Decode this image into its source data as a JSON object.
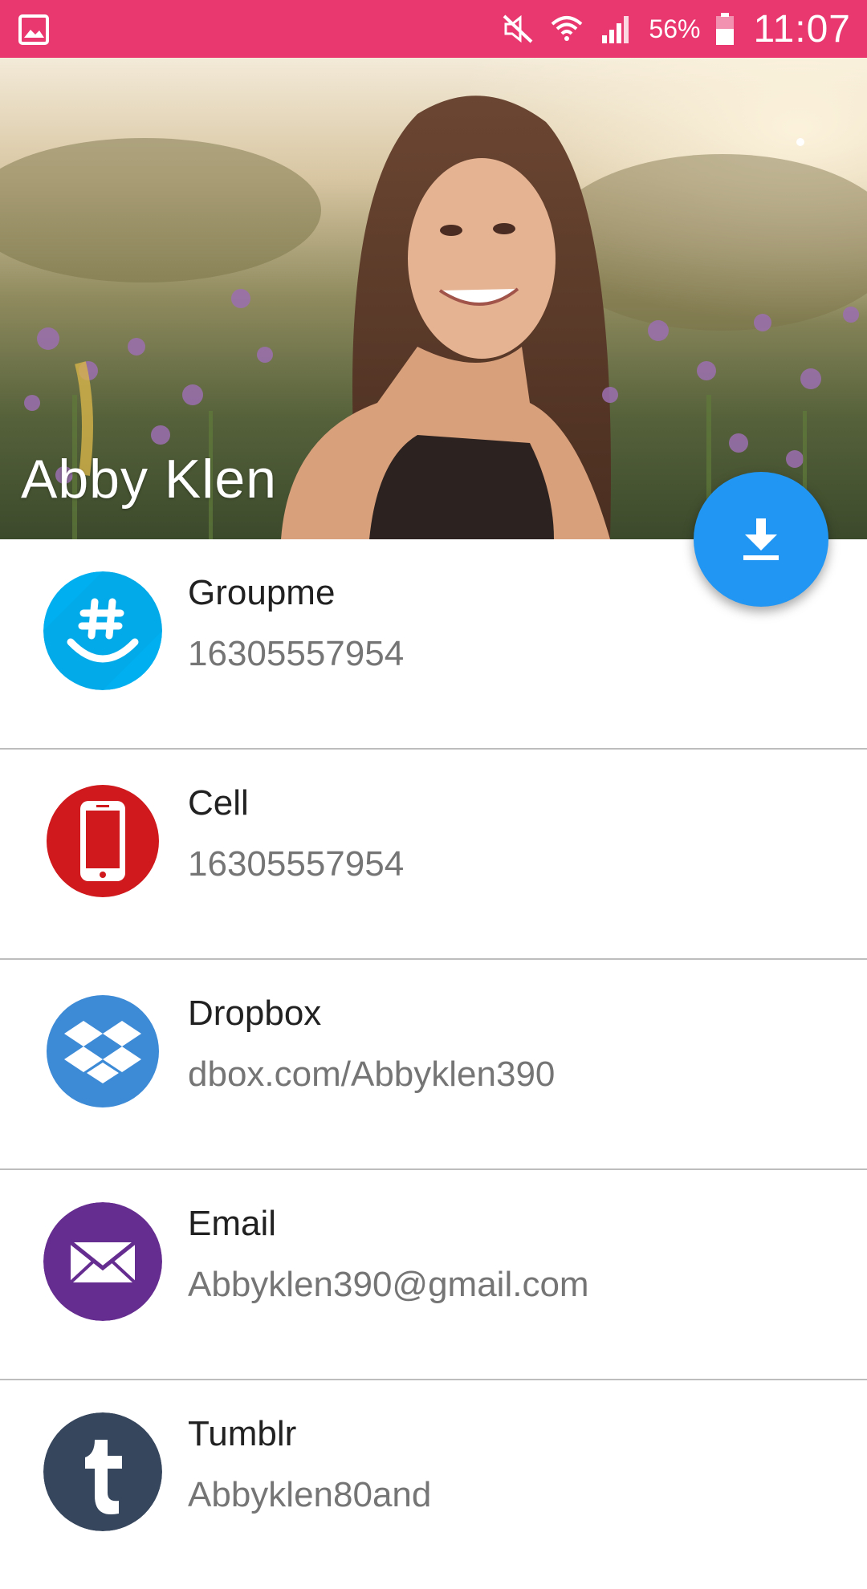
{
  "status_bar": {
    "battery": "56%",
    "time": "11:07",
    "background_color": "#e8386f",
    "icons": [
      "image-icon",
      "mute-icon",
      "wifi-icon",
      "signal-icon",
      "battery-icon"
    ]
  },
  "contact": {
    "name": "Abby  Klen"
  },
  "fab": {
    "icon": "download-icon",
    "color": "#2196f3"
  },
  "entries": [
    {
      "service": "Groupme",
      "value": "16305557954",
      "icon": "groupme-icon",
      "color": "#00aff0"
    },
    {
      "service": "Cell",
      "value": "16305557954",
      "icon": "phone-icon",
      "color": "#d0191c"
    },
    {
      "service": "Dropbox",
      "value": "dbox.com/Abbyklen390",
      "icon": "dropbox-icon",
      "color": "#3d8ad6"
    },
    {
      "service": "Email",
      "value": "Abbyklen390@gmail.com",
      "icon": "mail-icon",
      "color": "#662d91"
    },
    {
      "service": "Tumblr",
      "value": "Abbyklen80and",
      "icon": "tumblr-icon",
      "color": "#36465d"
    }
  ]
}
